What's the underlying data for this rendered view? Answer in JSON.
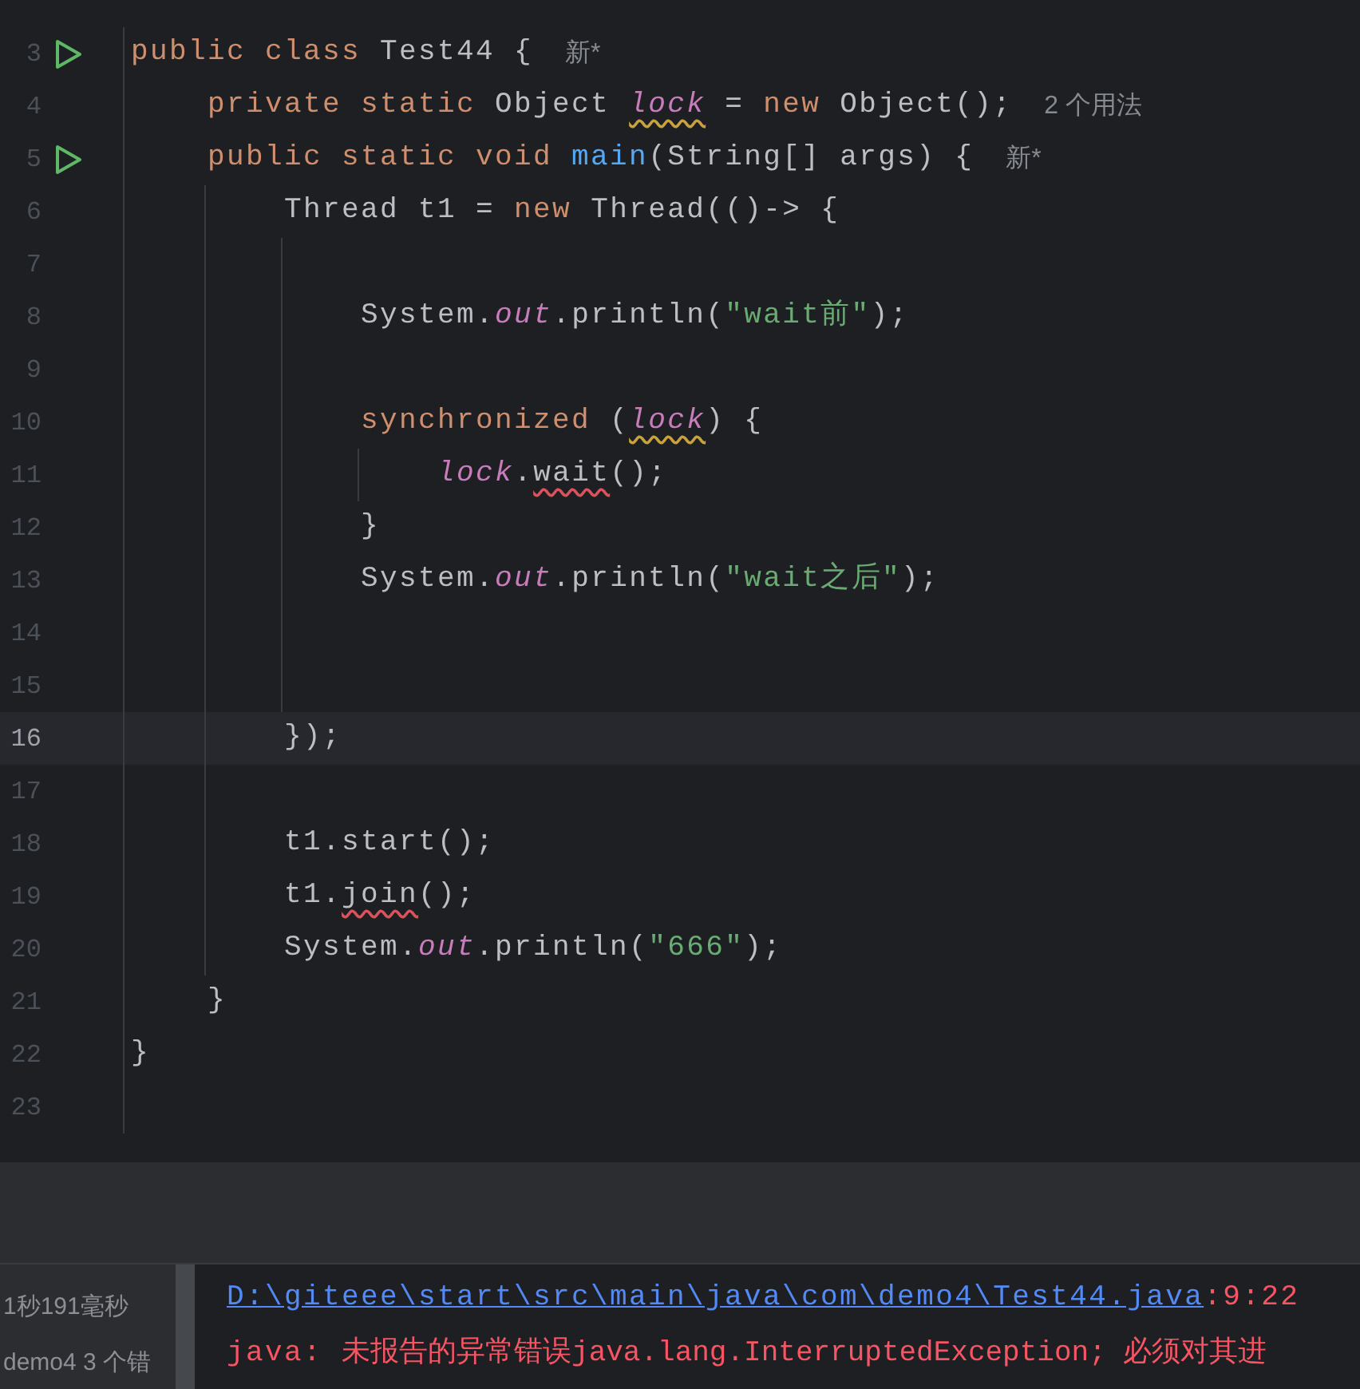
{
  "editor": {
    "lines": [
      {
        "number": "3",
        "selected": false,
        "runnable": true,
        "tokens": [
          {
            "kind": "keyword",
            "text": "public class "
          },
          {
            "kind": "plain",
            "text": "Test44 {"
          }
        ],
        "hint": "新*"
      },
      {
        "number": "4",
        "selected": false,
        "tokens": [
          {
            "kind": "keyword",
            "text": "    private static "
          },
          {
            "kind": "plain",
            "text": "Object "
          },
          {
            "kind": "field",
            "text": "lock",
            "warning": true
          },
          {
            "kind": "plain",
            "text": " = "
          },
          {
            "kind": "keyword",
            "text": "new "
          },
          {
            "kind": "plain",
            "text": "Object();"
          }
        ],
        "hint": "2 个用法"
      },
      {
        "number": "5",
        "selected": false,
        "runnable": true,
        "tokens": [
          {
            "kind": "keyword",
            "text": "    public static void "
          },
          {
            "kind": "method",
            "text": "main"
          },
          {
            "kind": "plain",
            "text": "(String[] args) {"
          }
        ],
        "hint": "新*"
      },
      {
        "number": "6",
        "selected": false,
        "tokens": [
          {
            "kind": "plain",
            "text": "        Thread t1 = "
          },
          {
            "kind": "keyword",
            "text": "new "
          },
          {
            "kind": "plain",
            "text": "Thread(()-> {"
          }
        ]
      },
      {
        "number": "7",
        "selected": false
      },
      {
        "number": "8",
        "selected": false,
        "tokens": [
          {
            "kind": "plain",
            "text": "            System."
          },
          {
            "kind": "field",
            "text": "out"
          },
          {
            "kind": "plain",
            "text": ".println("
          },
          {
            "kind": "string",
            "text": "\"wait前\""
          },
          {
            "kind": "plain",
            "text": ");"
          }
        ]
      },
      {
        "number": "9",
        "selected": false
      },
      {
        "number": "10",
        "selected": false,
        "tokens": [
          {
            "kind": "keyword",
            "text": "            synchronized"
          },
          {
            "kind": "plain",
            "text": " ("
          },
          {
            "kind": "field",
            "text": "lock",
            "warning": true
          },
          {
            "kind": "plain",
            "text": ") {"
          }
        ]
      },
      {
        "number": "11",
        "selected": false,
        "tokens": [
          {
            "kind": "field",
            "text": "                lock"
          },
          {
            "kind": "plain",
            "text": "."
          },
          {
            "kind": "plain",
            "text": "wait",
            "error": true
          },
          {
            "kind": "plain",
            "text": "();"
          }
        ]
      },
      {
        "number": "12",
        "selected": false,
        "tokens": [
          {
            "kind": "plain",
            "text": "            }"
          }
        ]
      },
      {
        "number": "13",
        "selected": false,
        "tokens": [
          {
            "kind": "plain",
            "text": "            System."
          },
          {
            "kind": "field",
            "text": "out"
          },
          {
            "kind": "plain",
            "text": ".println("
          },
          {
            "kind": "string",
            "text": "\"wait之后\""
          },
          {
            "kind": "plain",
            "text": ");"
          }
        ]
      },
      {
        "number": "14",
        "selected": false
      },
      {
        "number": "15",
        "selected": false
      },
      {
        "number": "16",
        "selected": true,
        "tokens": [
          {
            "kind": "plain",
            "text": "        });"
          }
        ]
      },
      {
        "number": "17",
        "selected": false
      },
      {
        "number": "18",
        "selected": false,
        "tokens": [
          {
            "kind": "plain",
            "text": "        t1.start();"
          }
        ]
      },
      {
        "number": "19",
        "selected": false,
        "tokens": [
          {
            "kind": "plain",
            "text": "        t1."
          },
          {
            "kind": "plain",
            "text": "join",
            "error": true
          },
          {
            "kind": "plain",
            "text": "();"
          }
        ]
      },
      {
        "number": "20",
        "selected": false,
        "tokens": [
          {
            "kind": "plain",
            "text": "        System."
          },
          {
            "kind": "field",
            "text": "out"
          },
          {
            "kind": "plain",
            "text": ".println("
          },
          {
            "kind": "string",
            "text": "\"666\""
          },
          {
            "kind": "plain",
            "text": ");"
          }
        ]
      },
      {
        "number": "21",
        "selected": false,
        "tokens": [
          {
            "kind": "plain",
            "text": "    }"
          }
        ]
      },
      {
        "number": "22",
        "selected": false,
        "tokens": [
          {
            "kind": "plain",
            "text": "}"
          }
        ]
      },
      {
        "number": "23",
        "selected": false
      }
    ]
  },
  "build_panel": {
    "tree": [
      "1秒191毫秒",
      "demo4 3 个错"
    ],
    "output": {
      "path": "D:\\giteee\\start\\src\\main\\java\\com\\demo4\\Test44.java",
      "position": ":9:22",
      "error_prefix": "java: ",
      "error_message": "未报告的异常错误java.lang.InterruptedException; 必须对其进"
    }
  }
}
